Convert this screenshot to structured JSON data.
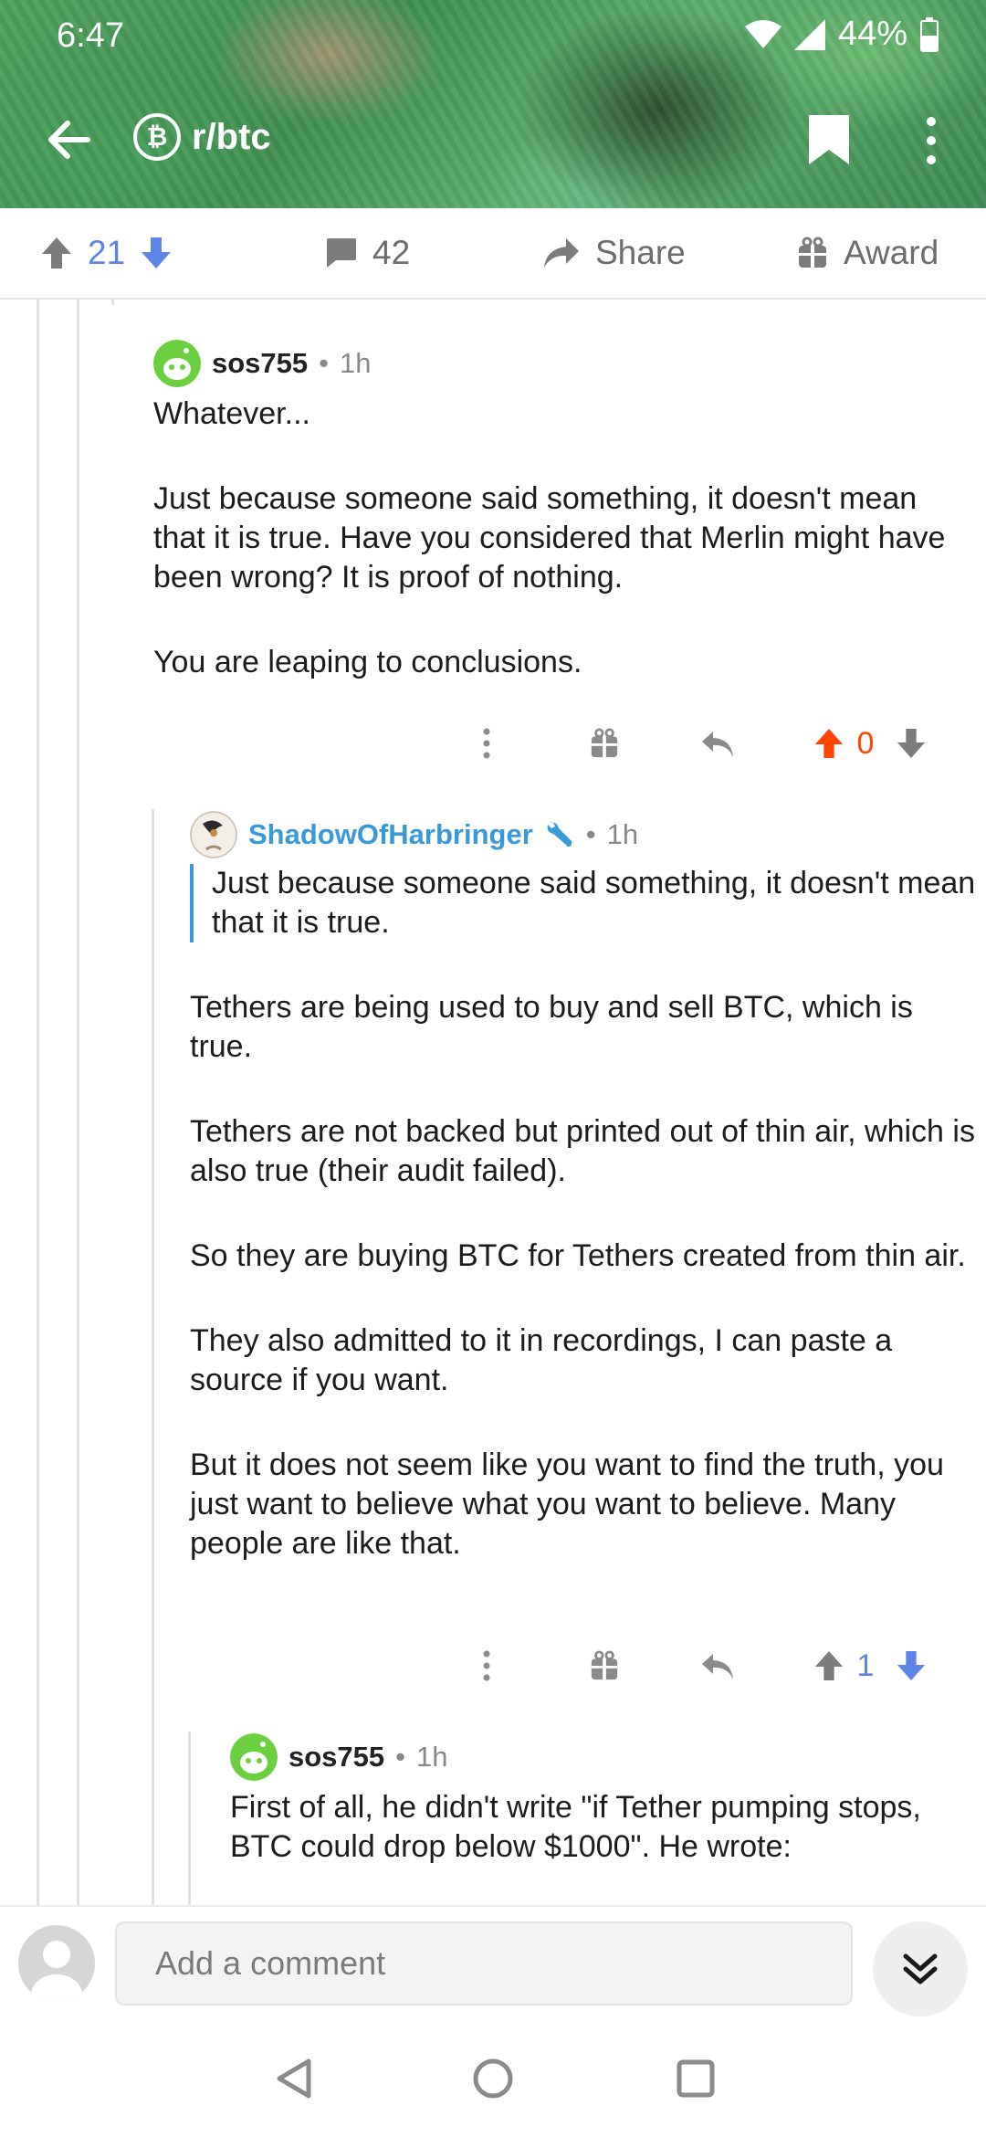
{
  "status_bar": {
    "time": "6:47",
    "battery": "44%"
  },
  "header": {
    "subreddit": "r/btc",
    "subreddit_icon": "bitcoin-icon"
  },
  "actions": {
    "score": "21",
    "comments": "42",
    "share": "Share",
    "award": "Award"
  },
  "comments": [
    {
      "author": "sos755",
      "separator": "•",
      "age": "1h",
      "paragraphs": [
        "Whatever...",
        "Just because someone said something, it doesn't mean that it is true. Have you considered that Merlin might have been wrong? It is proof of nothing.",
        "You are leaping to conclusions."
      ],
      "score": "0",
      "vote_state": "upvoted"
    },
    {
      "author": "ShadowOfHarbringer",
      "separator": "•",
      "age": "1h",
      "quote": "Just because someone said something, it doesn't mean that it is true.",
      "paragraphs": [
        "Tethers are being used to buy and sell BTC, which is true.",
        "Tethers are not backed but printed out of thin air, which is also true (their audit failed).",
        "So they are buying BTC for Tethers created from thin air.",
        "They also admitted to it in recordings, I can paste a source if you want.",
        "But it does not seem like you want to find the truth, you just want to believe what you want to believe. Many people are like that."
      ],
      "score": "1",
      "vote_state": "downvoted"
    },
    {
      "author": "sos755",
      "separator": "•",
      "age": "1h",
      "paragraphs": [
        "First of all, he didn't write \"if Tether pumping stops, BTC could drop below $1000\". He wrote:"
      ]
    }
  ],
  "composer": {
    "placeholder": "Add a comment"
  },
  "colors": {
    "upvote": "#ff4500",
    "downvote": "#5e84e8",
    "mod_blue": "#3a9ad9"
  }
}
